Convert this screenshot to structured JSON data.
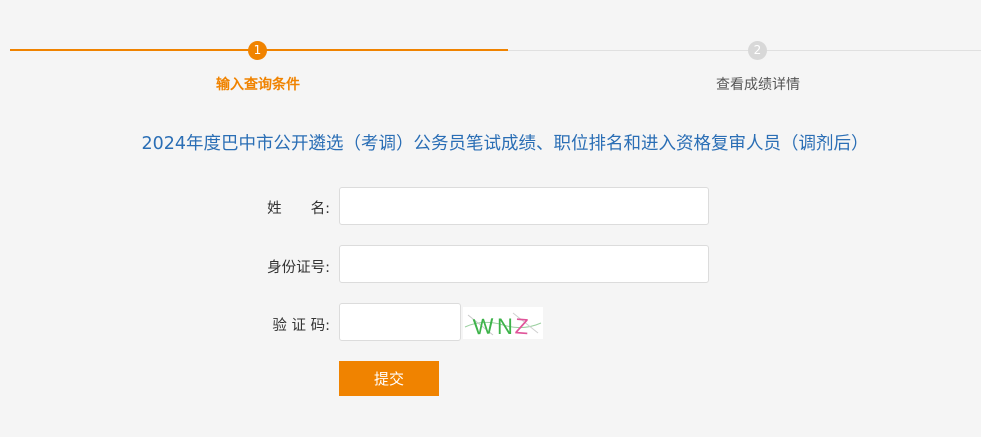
{
  "colors": {
    "accent": "#f08300",
    "inactive_circle": "#d8d8d8",
    "inactive_line": "#e0e0e0",
    "title_blue": "#2a6eb5",
    "inactive_text": "#555555"
  },
  "steps": [
    {
      "number": "1",
      "label": "输入查询条件",
      "active": true
    },
    {
      "number": "2",
      "label": "查看成绩详情",
      "active": false
    }
  ],
  "page_title": "2024年度巴中市公开遴选（考调）公务员笔试成绩、职位排名和进入资格复审人员（调剂后）",
  "form": {
    "name_label": "姓　　名:",
    "name_value": "",
    "id_label": "身份证号:",
    "id_value": "",
    "code_label": "验 证 码:",
    "code_value": "",
    "captcha_text": "WNZ",
    "submit_label": "提交"
  }
}
